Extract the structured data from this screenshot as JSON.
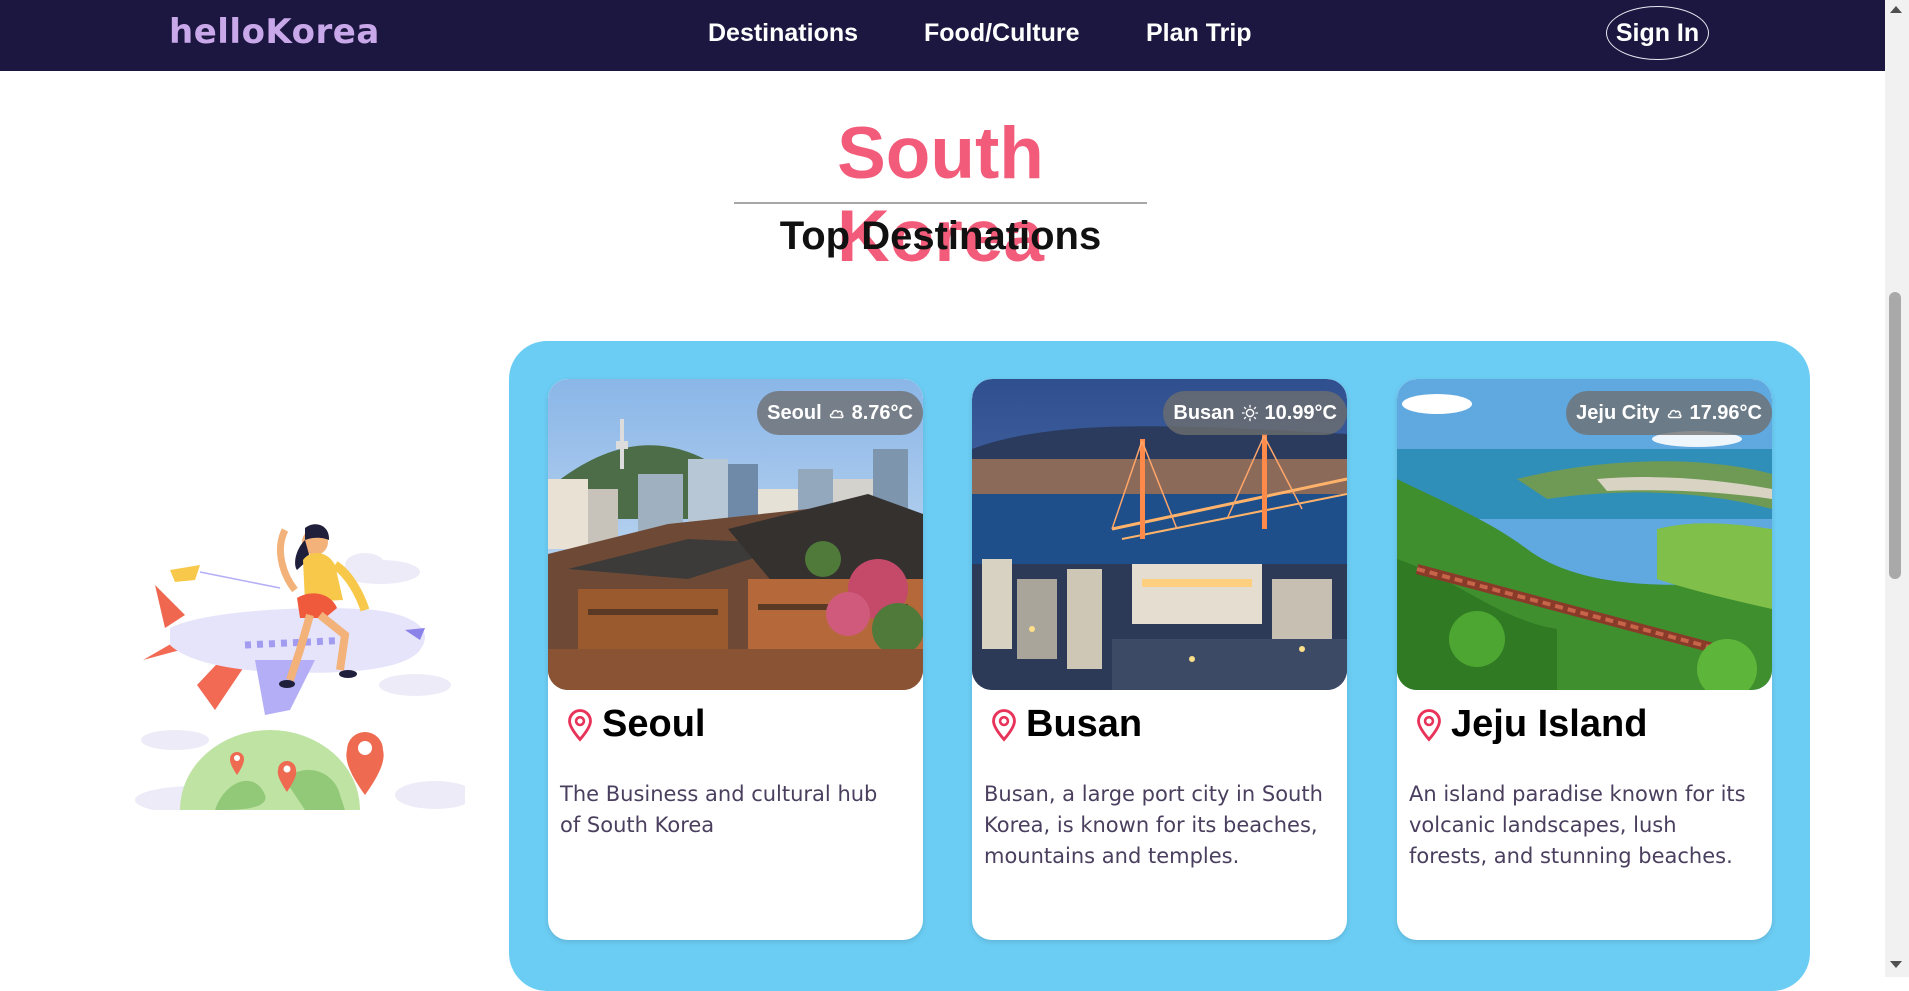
{
  "nav": {
    "brand": "helloKorea",
    "links": [
      "Destinations",
      "Food/Culture",
      "Plan Trip"
    ],
    "signin": "Sign In"
  },
  "hero": {
    "title": "South Korea",
    "subtitle": "Top Destinations"
  },
  "cards": [
    {
      "city": "Seoul",
      "weather_city": "Seoul",
      "weather_icon": "cloud-icon",
      "temp": "8.76°C",
      "desc": "The Business and cultural hub of South Korea"
    },
    {
      "city": "Busan",
      "weather_city": "Busan",
      "weather_icon": "sun-icon",
      "temp": "10.99°C",
      "desc": "Busan, a large port city in South Korea, is known for its beaches, mountains and temples."
    },
    {
      "city": "Jeju Island",
      "weather_city": "Jeju City",
      "weather_icon": "cloud-icon",
      "temp": "17.96°C",
      "desc": "An island paradise known for its volcanic landscapes, lush forests, and stunning beaches."
    }
  ],
  "colors": {
    "navbar": "#1b1740",
    "brand": "#c9a8ea",
    "title": "#f25c7a",
    "panel": "#6ccdf4",
    "pin": "#e8335a"
  }
}
